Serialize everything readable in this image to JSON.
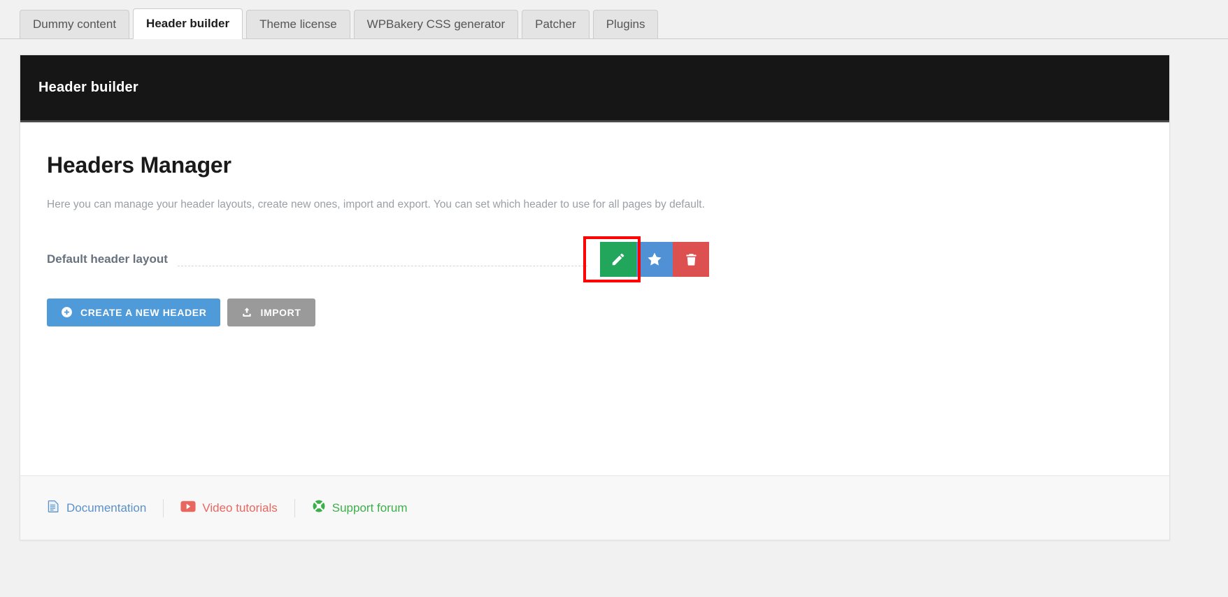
{
  "tabs": [
    {
      "label": "Dummy content",
      "active": false
    },
    {
      "label": "Header builder",
      "active": true
    },
    {
      "label": "Theme license",
      "active": false
    },
    {
      "label": "WPBakery CSS generator",
      "active": false
    },
    {
      "label": "Patcher",
      "active": false
    },
    {
      "label": "Plugins",
      "active": false
    }
  ],
  "panel": {
    "head_title": "Header builder",
    "page_title": "Headers Manager",
    "description": "Here you can manage your header layouts, create new ones, import and export. You can set which header to use for all pages by default."
  },
  "header_row": {
    "name": "Default header layout",
    "actions": [
      {
        "icon": "pencil-icon",
        "name": "edit-header-button",
        "color": "#22a65c",
        "title": "Edit"
      },
      {
        "icon": "star-icon",
        "name": "set-default-header-button",
        "color": "#4f91d4",
        "title": "Set as default"
      },
      {
        "icon": "trash-icon",
        "name": "delete-header-button",
        "color": "#dd5050",
        "title": "Delete"
      }
    ],
    "highlight_color": "#ff0000"
  },
  "buttons": {
    "create": {
      "label": "CREATE A NEW HEADER",
      "icon": "plus-circle-icon",
      "color": "#4f9bd9"
    },
    "import": {
      "label": "IMPORT",
      "icon": "upload-icon",
      "color": "#9a9a9a"
    }
  },
  "footer": {
    "links": [
      {
        "label": "Documentation",
        "icon": "document-icon",
        "color": "#5b91c7"
      },
      {
        "label": "Video tutorials",
        "icon": "youtube-play-icon",
        "color": "#e8675f"
      },
      {
        "label": "Support forum",
        "icon": "lifebuoy-icon",
        "color": "#3bb04a"
      }
    ]
  }
}
